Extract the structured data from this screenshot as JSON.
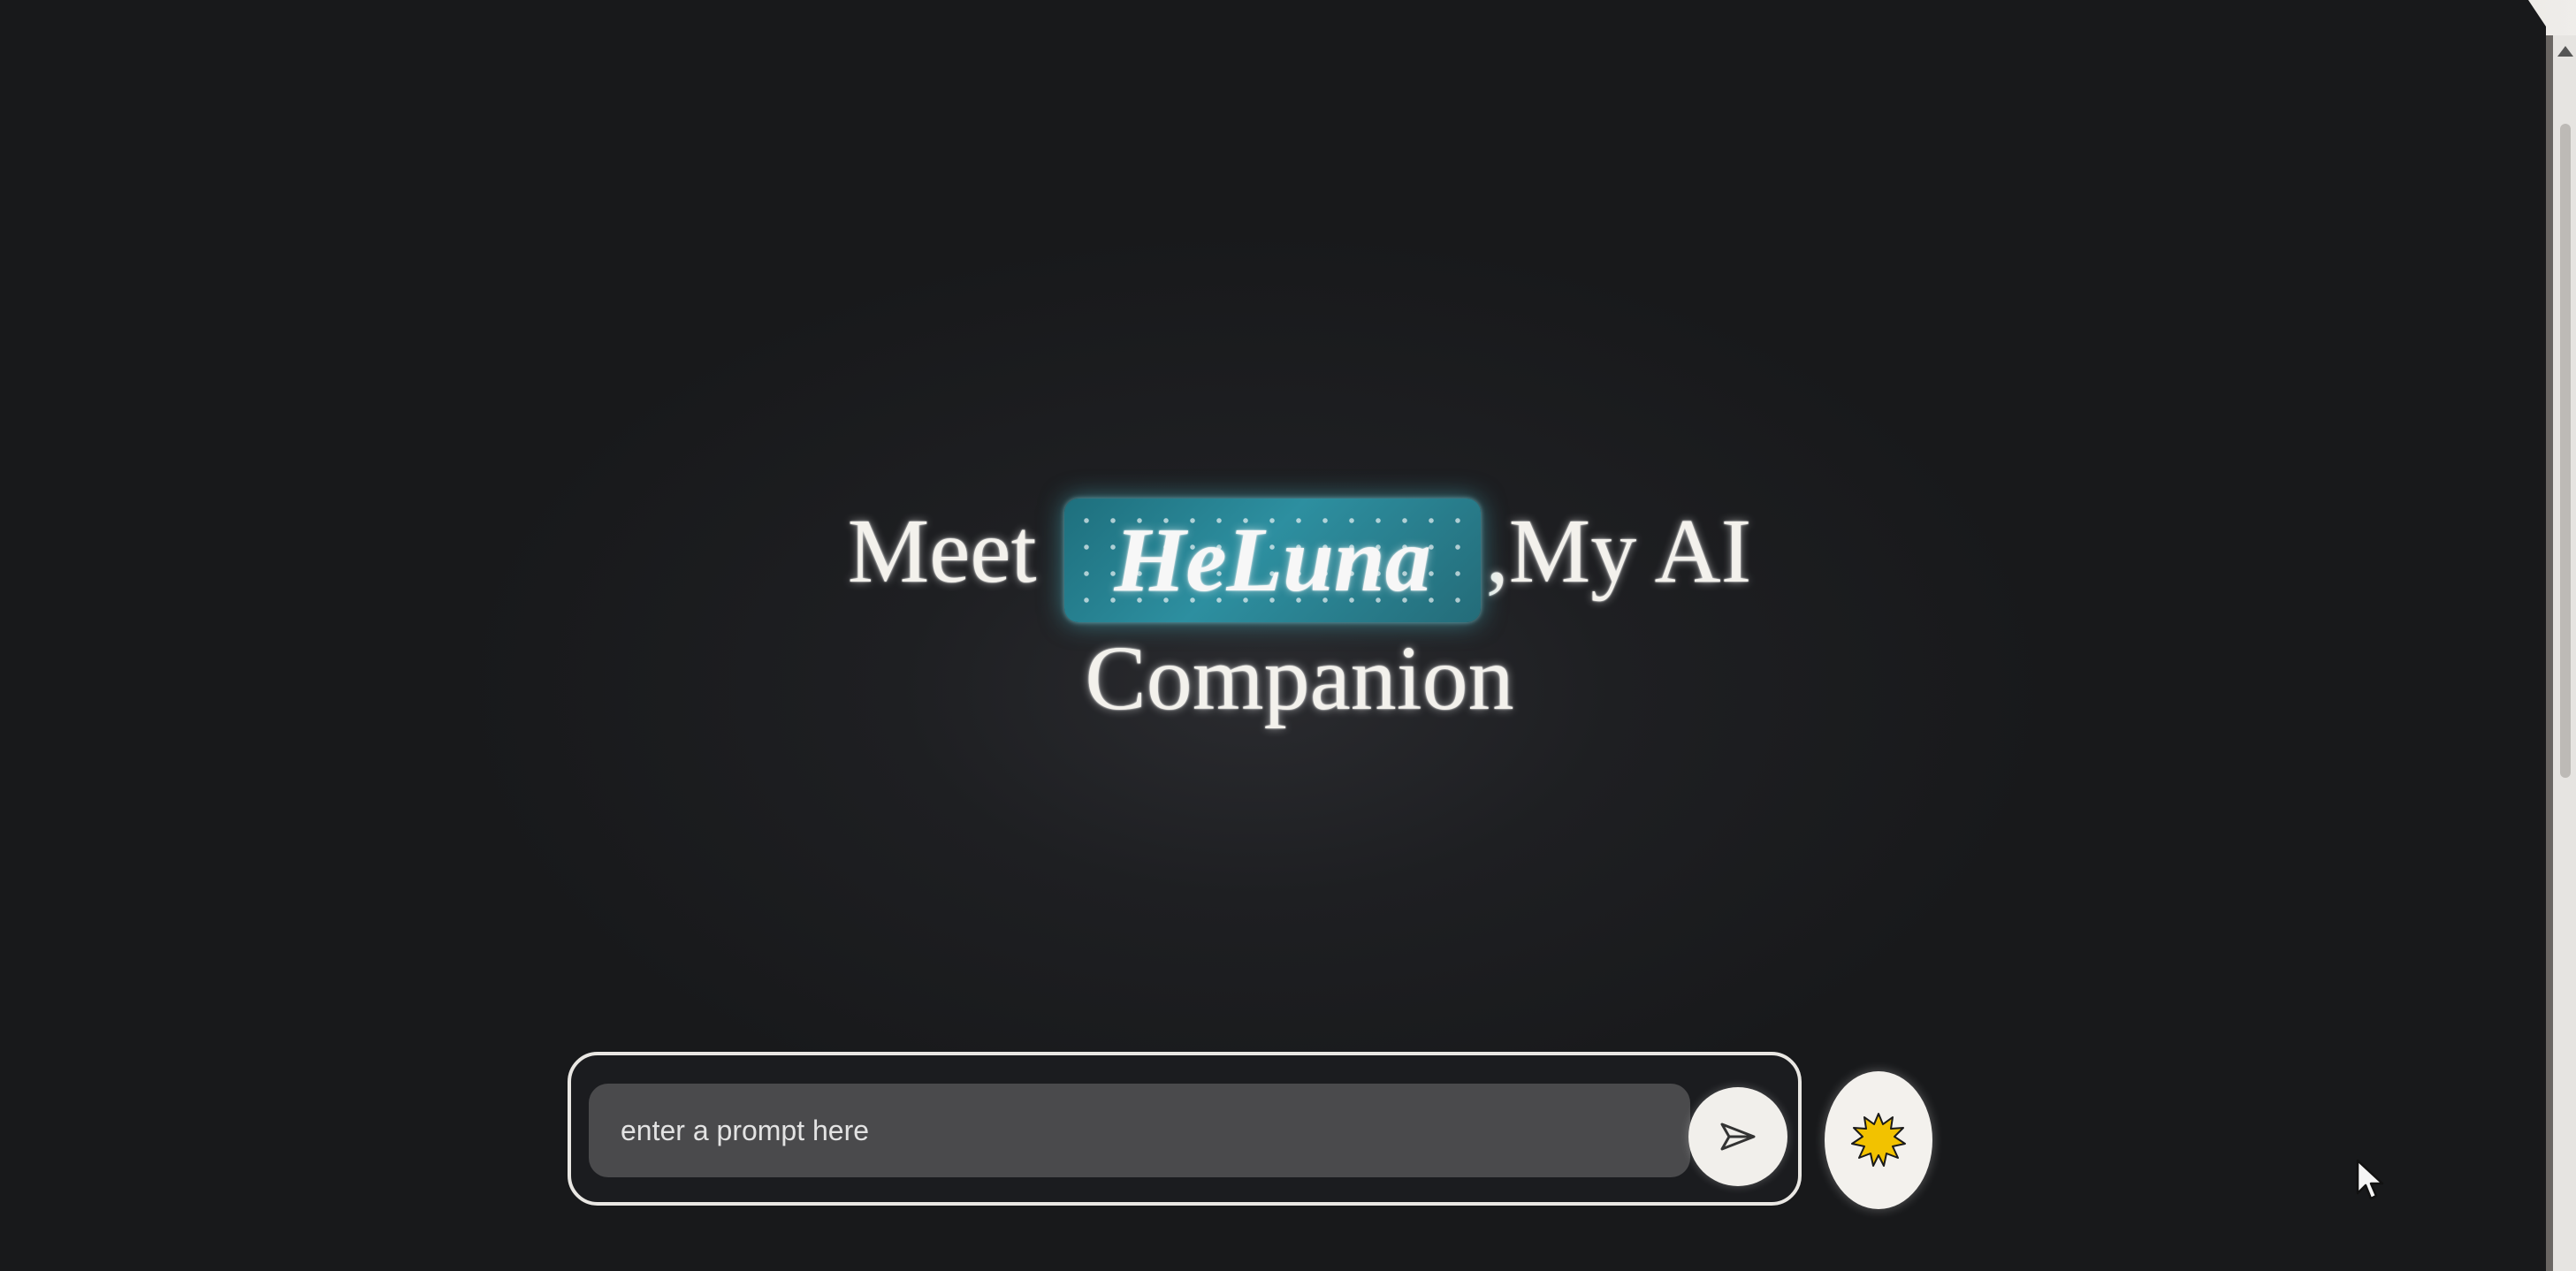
{
  "hero": {
    "prefix": "Meet",
    "name": "HeLuna",
    "suffix": ",My AI",
    "line2": "Companion"
  },
  "prompt": {
    "placeholder": "enter a prompt here",
    "send_icon": "send-icon",
    "theme_icon": "sun-icon"
  },
  "colors": {
    "background": "#1e1f22",
    "name_highlight": "#2d8fa0",
    "text": "#f3f1ec",
    "sun": "#f2c200"
  }
}
